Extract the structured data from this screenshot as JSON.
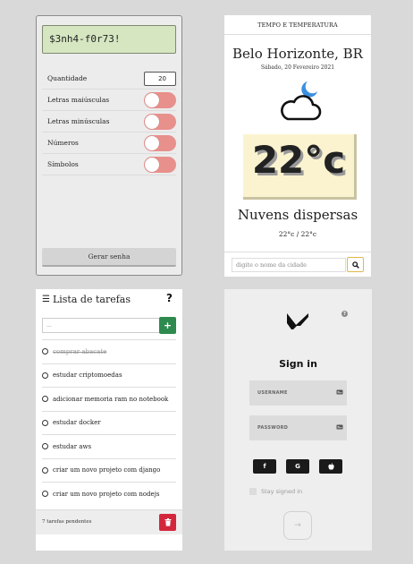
{
  "password_generator": {
    "generated_password": "$3nh4-f0r73!",
    "quantity_label": "Quantidade",
    "quantity_value": "20",
    "options": [
      {
        "label": "Letras maiúsculas",
        "enabled": false
      },
      {
        "label": "Letras minúsculas",
        "enabled": false
      },
      {
        "label": "Números",
        "enabled": false
      },
      {
        "label": "Símbolos",
        "enabled": false
      }
    ],
    "generate_button": "Gerar senha",
    "toggle_color": "#e8908c"
  },
  "weather": {
    "header": "TEMPO E TEMPERATURA",
    "city": "Belo Horizonte, BR",
    "date": "Sábado, 20 Fevereiro 2021",
    "icon": "night-cloud-icon",
    "temperature": "22°c",
    "description": "Nuvens dispersas",
    "min_max": "22°c / 22°c",
    "search_placeholder": "digite o nome da cidade",
    "accent_color": "#e2b84b",
    "temp_box_color": "#fbf3cf"
  },
  "todo": {
    "title": "Lista de tarefas",
    "help": "?",
    "input_placeholder": "...",
    "add_label": "+",
    "items": [
      {
        "text": "comprar abacate",
        "done": true
      },
      {
        "text": "estudar criptomoedas",
        "done": false
      },
      {
        "text": "adicionar memoria ram no notebook",
        "done": false
      },
      {
        "text": "estudar docker",
        "done": false
      },
      {
        "text": "estudar aws",
        "done": false
      },
      {
        "text": "criar um novo projeto com django",
        "done": false
      },
      {
        "text": "criar um novo projeto com nodejs",
        "done": false
      }
    ],
    "pending": "7 tarefas pendentes",
    "add_color": "#2e8a4e",
    "delete_color": "#d3263c"
  },
  "signin": {
    "title": "Sign in",
    "help": "?",
    "username_placeholder": "USERNAME",
    "password_placeholder": "PASSWORD",
    "social": [
      {
        "name": "facebook-icon",
        "glyph": "f"
      },
      {
        "name": "google-icon",
        "glyph": "G"
      },
      {
        "name": "apple-icon",
        "glyph": ""
      }
    ],
    "stay_signed_in": "Stay signed in",
    "submit_glyph": "→"
  }
}
